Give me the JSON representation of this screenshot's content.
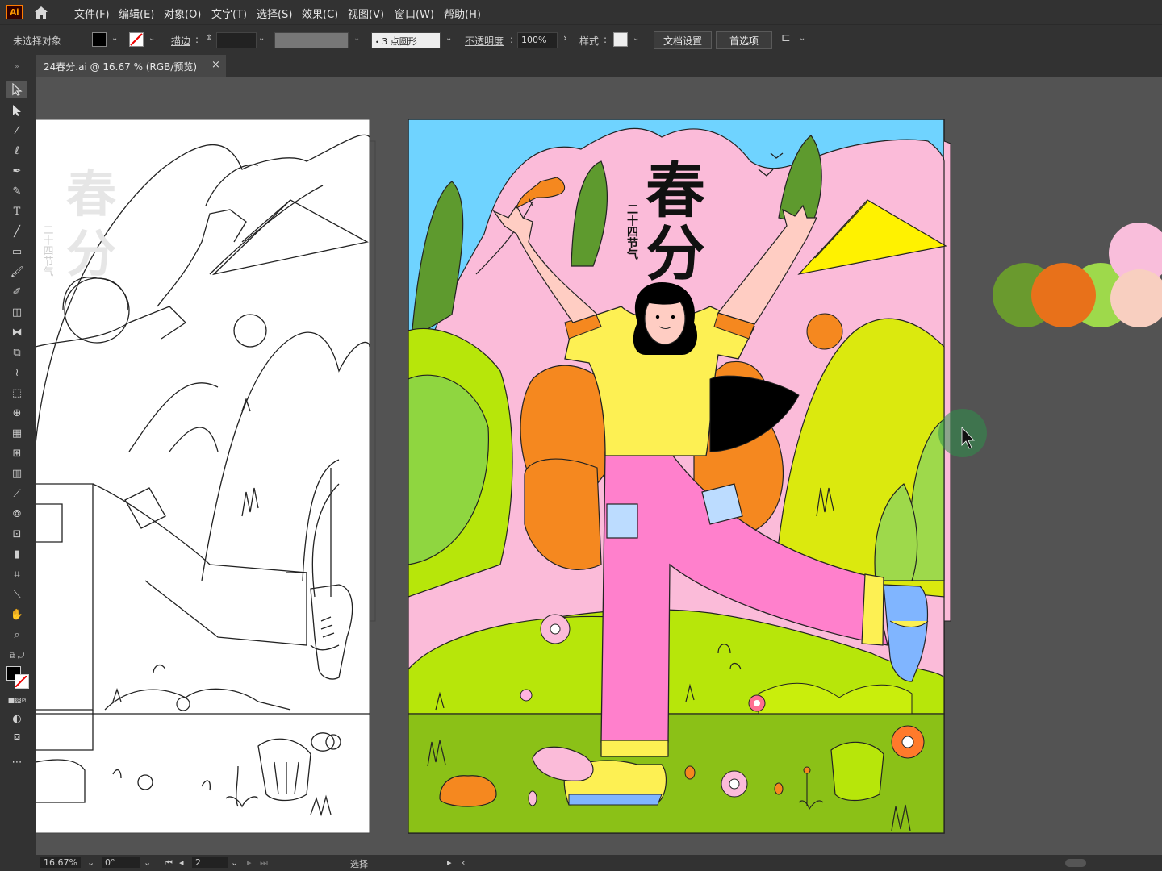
{
  "app": {
    "logo_text": "Ai",
    "home_icon": "home-icon"
  },
  "menu": [
    "文件(F)",
    "编辑(E)",
    "对象(O)",
    "文字(T)",
    "选择(S)",
    "效果(C)",
    "视图(V)",
    "窗口(W)",
    "帮助(H)"
  ],
  "control": {
    "selection_status": "未选择对象",
    "stroke_label": "描边",
    "brush_label": "3 点圆形",
    "opacity_label": "不透明度",
    "opacity_value": "100%",
    "style_label": "样式",
    "doc_setup": "文档设置",
    "preferences": "首选项"
  },
  "tab": {
    "title": "24春分.ai @ 16.67 % (RGB/预览)",
    "close": "×"
  },
  "artwork": {
    "title": "春分",
    "subtitle": "二十四节气",
    "color_sky": "#6fd3ff",
    "color_mountain": "#fbbbd9",
    "color_grass_dark": "#8bc117",
    "color_grass_light": "#b7e60a",
    "color_orange": "#f5881f",
    "color_yellow": "#fdf053",
    "color_pink_pants": "#ff80cc"
  },
  "palette": [
    "#6a9a2e",
    "#e8711a",
    "#9ed94b",
    "#f9bedb",
    "#f8cfc0"
  ],
  "status": {
    "zoom": "16.67%",
    "rotation": "0°",
    "artboard": "2",
    "mode": "选择"
  }
}
